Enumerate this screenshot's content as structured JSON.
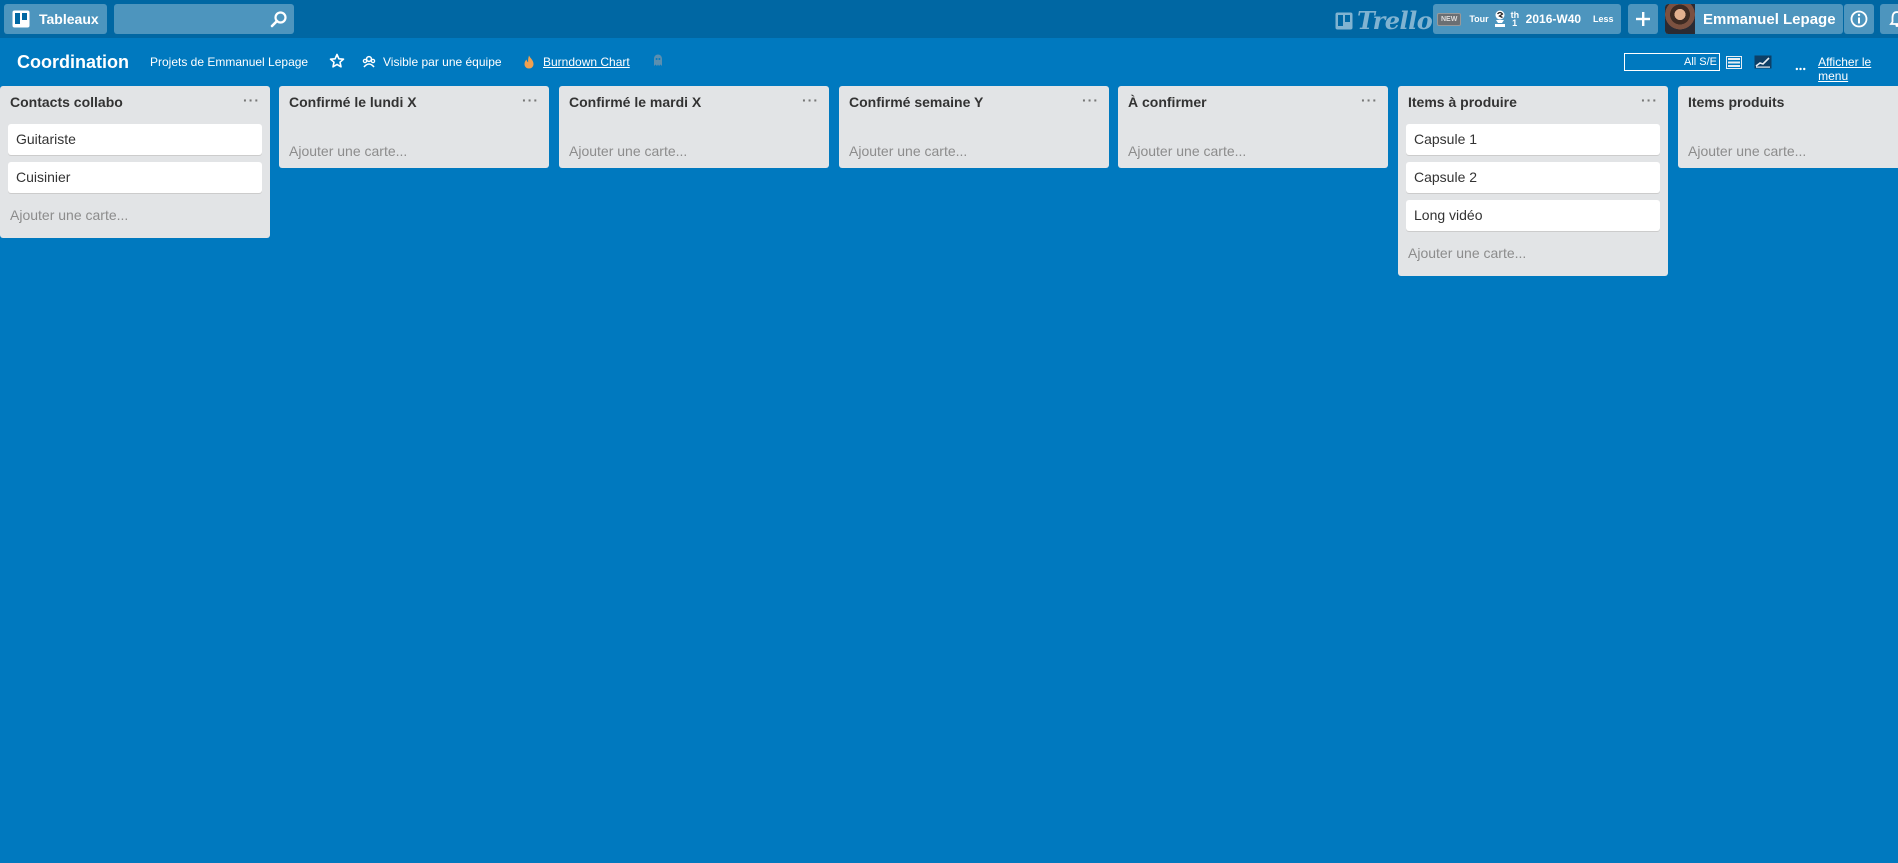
{
  "header": {
    "boards_label": "Tableaux",
    "search_value": "",
    "logo_text": "Trello",
    "tour": {
      "new_badge": "NEW",
      "tour_label": "Tour",
      "rank": "th\n1",
      "week": "2016-W40",
      "less_label": "Less"
    },
    "add_symbol": "+",
    "user_name": "Emmanuel Lepage"
  },
  "board": {
    "title": "Coordination",
    "team": "Projets de Emmanuel Lepage",
    "visibility": "Visible par une équipe",
    "burndown": "Burndown Chart",
    "filter_value": "All S/E",
    "menu_label": "Afficher le menu"
  },
  "lists": [
    {
      "title": "Contacts collabo",
      "menu": "···",
      "cards": [
        "Guitariste",
        "Cuisinier"
      ],
      "add_label": "Ajouter une carte..."
    },
    {
      "title": "Confirmé le lundi X",
      "menu": "···",
      "cards": [],
      "add_label": "Ajouter une carte..."
    },
    {
      "title": "Confirmé le mardi X",
      "menu": "···",
      "cards": [],
      "add_label": "Ajouter une carte..."
    },
    {
      "title": "Confirmé semaine Y",
      "menu": "···",
      "cards": [],
      "add_label": "Ajouter une carte..."
    },
    {
      "title": "À confirmer",
      "menu": "···",
      "cards": [],
      "add_label": "Ajouter une carte..."
    },
    {
      "title": "Items à produire",
      "menu": "···",
      "cards": [
        "Capsule 1",
        "Capsule 2",
        "Long vidéo"
      ],
      "add_label": "Ajouter une carte..."
    },
    {
      "title": "Items produits",
      "menu": "···",
      "cards": [],
      "add_label": "Ajouter une carte..."
    }
  ],
  "colors": {
    "board_background": "#0079bf",
    "header_background": "#0067a3",
    "list_background": "#e2e4e6",
    "card_background": "#ffffff",
    "burndown_flame": "#f0a050"
  },
  "icons": {
    "boards": "boards-icon",
    "search": "search-icon",
    "logo": "trello-logo-icon",
    "podium": "podium-icon",
    "add": "plus-icon",
    "info": "info-icon",
    "bell": "bell-icon",
    "star": "star-icon",
    "visibility": "team-visibility-icon",
    "burndown": "flame-icon",
    "ghost": "ghost-icon",
    "list_view": "list-view-icon",
    "chart_view": "chart-view-icon",
    "menu": "more-icon"
  }
}
